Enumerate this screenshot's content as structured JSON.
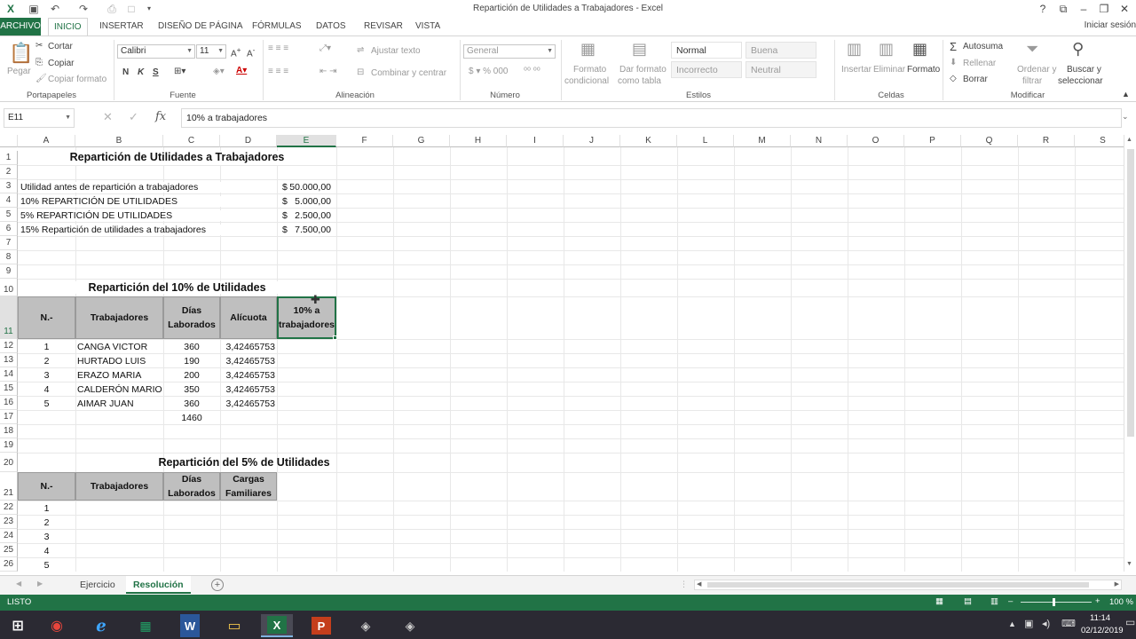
{
  "window": {
    "title": "Repartición de Utilidades a Trabajadores - Excel"
  },
  "ribbon_tabs": [
    "ARCHIVO",
    "INICIO",
    "INSERTAR",
    "DISEÑO DE PÁGINA",
    "FÓRMULAS",
    "DATOS",
    "REVISAR",
    "VISTA"
  ],
  "signin": "Iniciar sesión",
  "ribbon": {
    "cut": "Cortar",
    "copy": "Copiar",
    "paste": "Pegar",
    "format_painter": "Copiar formato",
    "font_name": "Calibri",
    "font_size": "11",
    "bold": "N",
    "italic": "K",
    "underline": "S",
    "wrap_text": "Ajustar texto",
    "merge_center": "Combinar y centrar",
    "number_format": "General",
    "cond_format_1": "Formato",
    "cond_format_2": "condicional",
    "table_format_1": "Dar formato",
    "table_format_2": "como tabla",
    "styles": {
      "normal": "Normal",
      "good": "Buena",
      "bad": "Incorrecto",
      "neutral": "Neutral"
    },
    "insert": "Insertar",
    "delete": "Eliminar",
    "format": "Formato",
    "autosum": "Autosuma",
    "fill": "Rellenar",
    "clear": "Borrar",
    "sort_1": "Ordenar y",
    "sort_2": "filtrar",
    "find_1": "Buscar y",
    "find_2": "seleccionar",
    "groups": {
      "clipboard": "Portapapeles",
      "font": "Fuente",
      "alignment": "Alineación",
      "number": "Número",
      "styles": "Estilos",
      "cells": "Celdas",
      "edit": "Modificar"
    }
  },
  "formula_bar": {
    "name_box": "E11",
    "fx": "fx",
    "content": "10% a trabajadores"
  },
  "columns": [
    "A",
    "B",
    "C",
    "D",
    "E",
    "F",
    "G",
    "H",
    "I",
    "J",
    "K",
    "L",
    "M",
    "N",
    "O",
    "P",
    "Q",
    "R",
    "S"
  ],
  "rows": [
    "1",
    "2",
    "3",
    "4",
    "5",
    "6",
    "7",
    "8",
    "9",
    "10",
    "11",
    "12",
    "13",
    "14",
    "15",
    "16",
    "17",
    "18",
    "19",
    "20",
    "21",
    "22",
    "23",
    "24",
    "25",
    "26"
  ],
  "sheet": {
    "title1": "Repartición de Utilidades a Trabajadores",
    "summary": [
      {
        "label": "Utilidad antes de repartición a trabajadores",
        "cur": "$",
        "value": "50.000,00"
      },
      {
        "label": "10% REPARTICIÓN DE UTILIDADES",
        "cur": "$",
        "value": "5.000,00"
      },
      {
        "label": "5% REPARTICIÓN DE UTILIDADES",
        "cur": "$",
        "value": "2.500,00"
      },
      {
        "label": "15% Repartición de utilidades a trabajadores",
        "cur": "$",
        "value": "7.500,00"
      }
    ],
    "title2": "Repartición del 10% de Utilidades",
    "t1_headers": {
      "n": "N.-",
      "trab": "Trabajadores",
      "dias1": "Días",
      "dias2": "Laborados",
      "alic": "Alícuota",
      "e1": "10% a",
      "e2": "trabajadores"
    },
    "t1_rows": [
      {
        "n": "1",
        "name": "CANGA VICTOR",
        "dias": "360",
        "alic": "3,42465753"
      },
      {
        "n": "2",
        "name": "HURTADO LUIS",
        "dias": "190",
        "alic": "3,42465753"
      },
      {
        "n": "3",
        "name": "ERAZO MARIA",
        "dias": "200",
        "alic": "3,42465753"
      },
      {
        "n": "4",
        "name": "CALDERÓN MARIO",
        "dias": "350",
        "alic": "3,42465753"
      },
      {
        "n": "5",
        "name": "AIMAR JUAN",
        "dias": "360",
        "alic": "3,42465753"
      }
    ],
    "t1_total": "1460",
    "title3": "Repartición del 5% de Utilidades",
    "t2_headers": {
      "n": "N.-",
      "trab": "Trabajadores",
      "dias1": "Días",
      "dias2": "Laborados",
      "cargas1": "Cargas",
      "cargas2": "Familiares"
    },
    "t2_rows": [
      "1",
      "2",
      "3",
      "4",
      "5"
    ]
  },
  "sheet_tabs": [
    "Ejercicio",
    "Resolución"
  ],
  "status": {
    "ready": "LISTO",
    "zoom": "100 %"
  },
  "clock": {
    "time": "11:14",
    "date": "02/12/2019"
  },
  "colors": {
    "excel_green": "#217346",
    "header_gray": "#bfbfbf"
  }
}
